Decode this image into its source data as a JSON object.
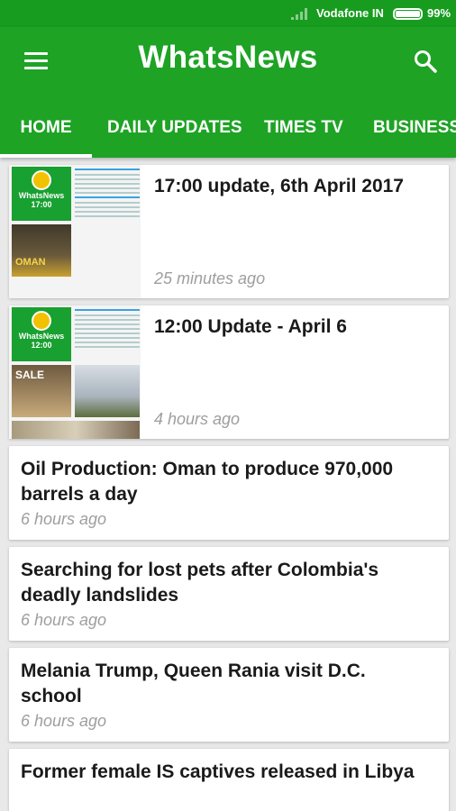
{
  "status_bar": {
    "carrier": "Vodafone IN",
    "battery": "99%",
    "battery_level": 0.99
  },
  "app_bar": {
    "title": "WhatsNews",
    "icons": [
      "menu-icon",
      "search-icon"
    ]
  },
  "tabs": [
    {
      "label": "HOME",
      "active": true
    },
    {
      "label": "DAILY UPDATES",
      "active": false
    },
    {
      "label": "TIMES TV",
      "active": false
    },
    {
      "label": "BUSINESS",
      "active": false
    }
  ],
  "thumbnails": {
    "logo_name": "WhatsNews",
    "first_logo_time": "17:00",
    "second_logo_time": "12:00",
    "first_photo_text": "OMAN",
    "second_photo_text": "SALE"
  },
  "feed": [
    {
      "title": "17:00 update, 6th April 2017",
      "time": "25 minutes ago"
    },
    {
      "title": "12:00 Update - April 6",
      "time": "4 hours ago"
    },
    {
      "title": "Oil Production: Oman to produce 970,000 barrels a day",
      "time": "6 hours ago"
    },
    {
      "title": "Searching for lost pets after Colombia's deadly landslides",
      "time": "6 hours ago"
    },
    {
      "title": "Melania Trump, Queen Rania visit D.C. school",
      "time": "6 hours ago"
    },
    {
      "title": "Former female IS captives released in Libya",
      "time": ""
    }
  ],
  "colors": {
    "status_bar": "#179c1f",
    "app_bar": "#1ea325",
    "background": "#e9e9e9",
    "card": "#ffffff",
    "timestamp": "#9e9e9e"
  }
}
